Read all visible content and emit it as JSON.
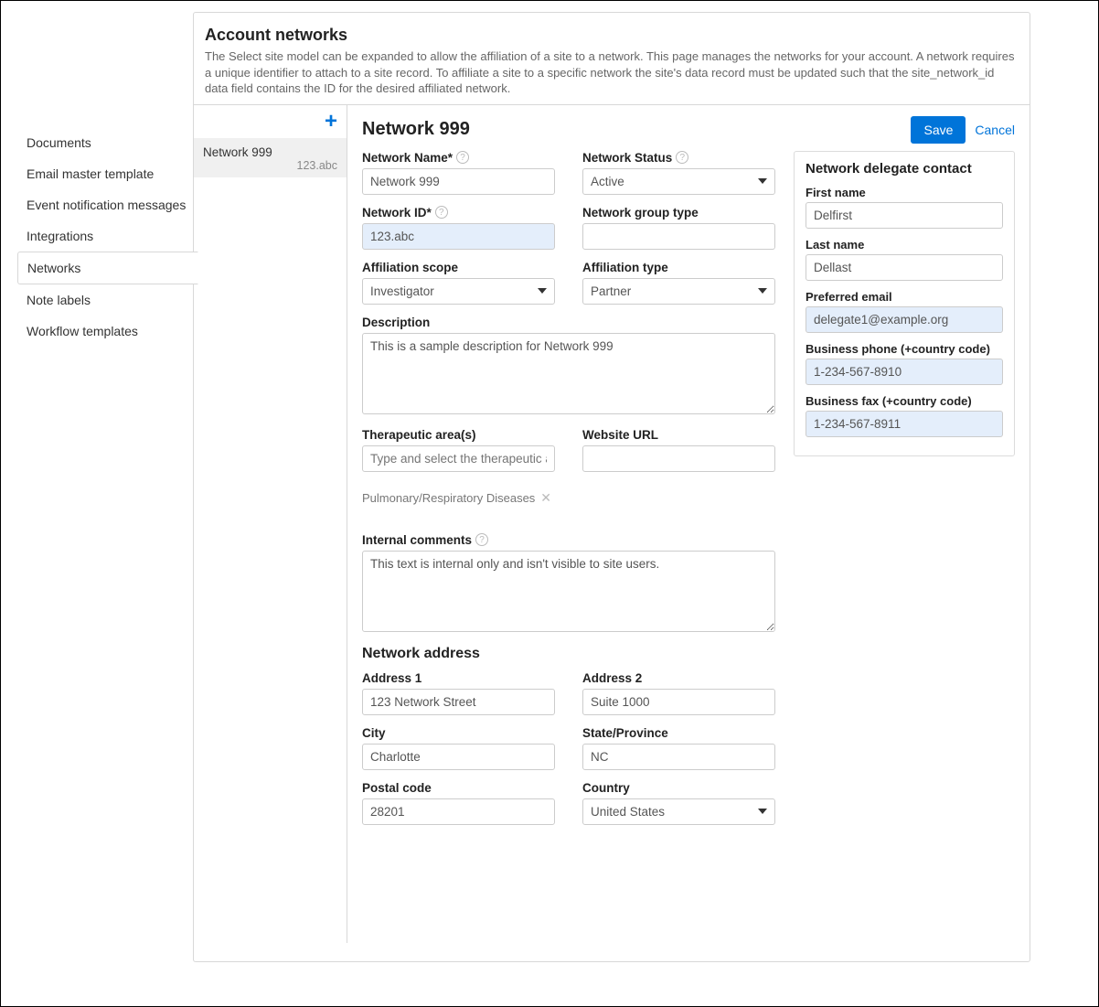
{
  "sidebar": {
    "items": [
      {
        "label": "Documents"
      },
      {
        "label": "Email master template"
      },
      {
        "label": "Event notification messages"
      },
      {
        "label": "Integrations"
      },
      {
        "label": "Networks",
        "active": true
      },
      {
        "label": "Note labels"
      },
      {
        "label": "Workflow templates"
      }
    ]
  },
  "header": {
    "title": "Account networks",
    "description": "The Select site model can be expanded to allow the affiliation of a site to a network. This page manages the networks for your account. A network requires a unique identifier to attach to a site record. To affiliate a site to a specific network the site's data record must be updated such that the site_network_id data field contains the ID for the desired affiliated network."
  },
  "list": {
    "add_label": "+",
    "items": [
      {
        "name": "Network 999",
        "sub": "123.abc",
        "selected": true
      }
    ]
  },
  "form": {
    "title": "Network 999",
    "actions": {
      "save": "Save",
      "cancel": "Cancel"
    },
    "labels": {
      "network_name": "Network Name*",
      "network_status": "Network Status",
      "network_id": "Network ID*",
      "network_group": "Network group type",
      "affiliation_scope": "Affiliation scope",
      "affiliation_type": "Affiliation type",
      "description": "Description",
      "therapeutic": "Therapeutic area(s)",
      "website": "Website URL",
      "internal": "Internal comments",
      "address_section": "Network address",
      "address1": "Address 1",
      "address2": "Address 2",
      "city": "City",
      "state": "State/Province",
      "postal": "Postal code",
      "country": "Country"
    },
    "values": {
      "network_name": "Network 999",
      "network_status": "Active",
      "network_id": "123.abc",
      "network_group": "",
      "affiliation_scope": "Investigator",
      "affiliation_type": "Partner",
      "description": "This is a sample description for Network 999",
      "therapeutic_placeholder": "Type and select the therapeutic areas",
      "website": "",
      "therapeutic_chip": "Pulmonary/Respiratory Diseases",
      "internal": "This text is internal only and isn't visible to site users.",
      "address1": "123 Network Street",
      "address2": "Suite 1000",
      "city": "Charlotte",
      "state": "NC",
      "postal": "28201",
      "country": "United States"
    }
  },
  "delegate": {
    "title": "Network delegate contact",
    "labels": {
      "first": "First name",
      "last": "Last name",
      "email": "Preferred email",
      "phone": "Business phone (+country code)",
      "fax": "Business fax (+country code)"
    },
    "values": {
      "first": "Delfirst",
      "last": "Dellast",
      "email": "delegate1@example.org",
      "phone": "1-234-567-8910",
      "fax": "1-234-567-8911"
    }
  }
}
